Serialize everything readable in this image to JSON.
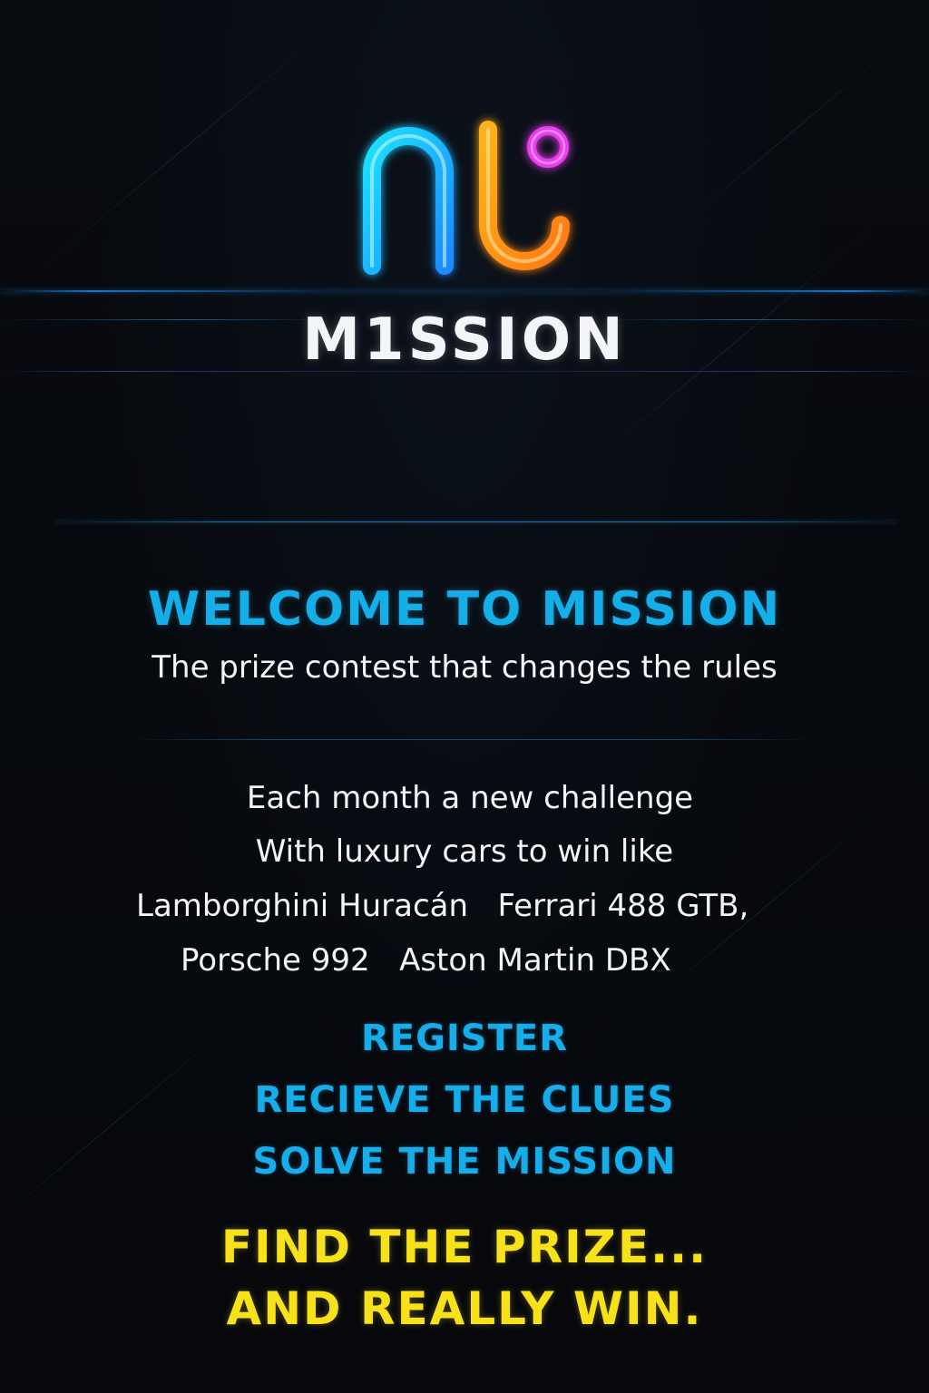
{
  "brand": {
    "wordmark": "M1SSION",
    "logo_icon": "neon-nl-monogram-icon",
    "colors": {
      "cyan": "#1ec8f5",
      "orange": "#ff9a1a",
      "magenta": "#e93cf0"
    }
  },
  "welcome": {
    "title": "WELCOME TO MISSION",
    "subtitle": "The prize contest that changes the rules"
  },
  "description": {
    "line1": "Each month a new challenge",
    "line2": "With luxury cars to win like",
    "line3": "Lamborghini Huracán   Ferrari 488 GTB,",
    "line4": "Porsche 992   Aston Martin DBX"
  },
  "steps": [
    "REGISTER",
    "RECIEVE THE CLUES",
    "SOLVE THE MISSION"
  ],
  "cta": {
    "line1": "FIND THE PRIZE...",
    "line2": "AND REALLY WIN."
  },
  "theme": {
    "background": "#07090d",
    "accent_blue": "#17acea",
    "accent_yellow": "#f7e11a",
    "text": "#f2f4f7"
  }
}
